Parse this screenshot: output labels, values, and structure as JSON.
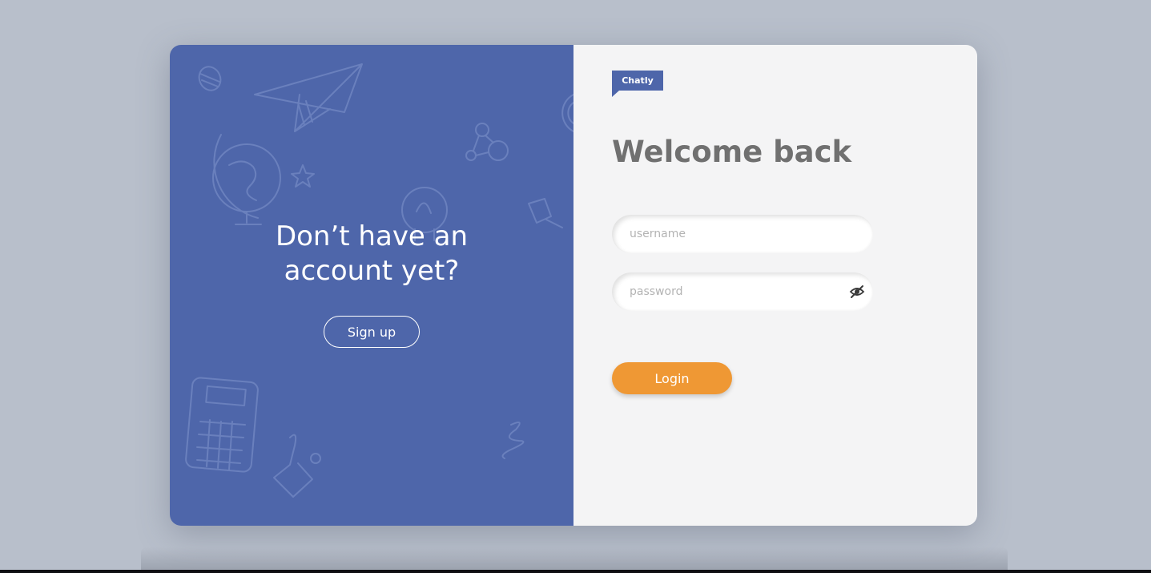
{
  "promo": {
    "title": "Don’t have an account yet?",
    "signup_label": "Sign up"
  },
  "brand": {
    "name": "Chatly"
  },
  "login": {
    "heading": "Welcome back",
    "username_placeholder": "username",
    "username_value": "",
    "password_placeholder": "password",
    "password_value": "",
    "submit_label": "Login"
  },
  "icons": {
    "password_toggle": "eye-slash-icon",
    "doodles": [
      "planet-icon",
      "paper-plane-icon",
      "globe-icon",
      "star-icon",
      "molecule-icon",
      "lightbulb-icon",
      "pushpin-icon",
      "calculator-icon",
      "spring-icon",
      "headphone-icon"
    ]
  },
  "colors": {
    "left_panel": "#4e66aa",
    "accent": "#ef9834",
    "right_panel": "#f4f4f5",
    "heading": "#707070",
    "background": "#b8bfcb"
  }
}
